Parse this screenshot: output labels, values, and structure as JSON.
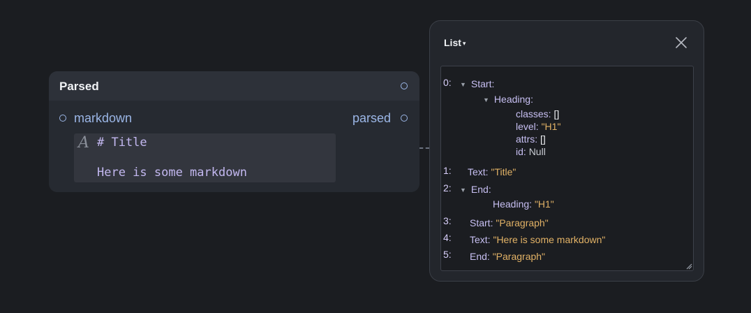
{
  "node": {
    "title": "Parsed",
    "input_label": "markdown",
    "output_label": "parsed",
    "editor_icon": "A",
    "editor_lines": [
      "# Title",
      "",
      "Here is some markdown"
    ]
  },
  "panel": {
    "title": "List",
    "caret": "▾",
    "close_icon": "close-icon",
    "items": [
      {
        "index": "0:",
        "key": "Start:",
        "children": [
          {
            "key": "Heading:",
            "fields": [
              {
                "key": "classes:",
                "value": "[]"
              },
              {
                "key": "level:",
                "value": "\"H1\""
              },
              {
                "key": "attrs:",
                "value": "[]"
              },
              {
                "key": "id:",
                "value": "Null"
              }
            ]
          }
        ]
      },
      {
        "index": "1:",
        "key": "Text:",
        "value": "\"Title\""
      },
      {
        "index": "2:",
        "key": "End:",
        "child_key": "Heading:",
        "child_value": "\"H1\""
      },
      {
        "index": "3:",
        "key": "Start:",
        "value": "\"Paragraph\""
      },
      {
        "index": "4:",
        "key": "Text:",
        "value": "\"Here is some markdown\""
      },
      {
        "index": "5:",
        "key": "End:",
        "value": "\"Paragraph\""
      }
    ]
  },
  "colors": {
    "background": "#1b1d21",
    "node_body": "#262a31",
    "port_accent": "#9bb6e6",
    "key_text": "#c7bff2",
    "string_value": "#e2b266"
  }
}
